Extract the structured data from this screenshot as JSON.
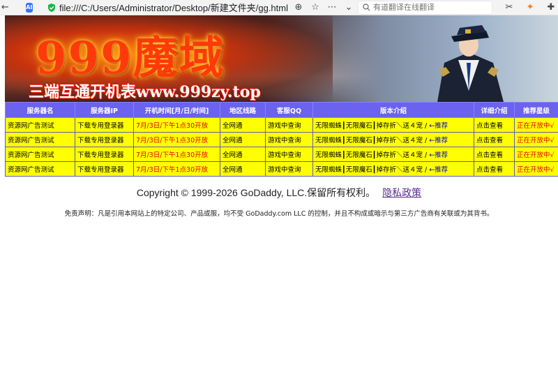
{
  "browser": {
    "url": "file:///C:/Users/Administrator/Desktop/新建文件夹/gg.html",
    "ai_label": "AI",
    "search_placeholder": "有道翻译在线翻译"
  },
  "banner": {
    "logo_text": "999魔域",
    "tagline": "三端互通开机表www.999zy.top"
  },
  "table": {
    "headers": [
      "服务器名",
      "服务器IP",
      "开机时间[月/日/时间]",
      "地区线路",
      "客服QQ",
      "版本介绍",
      "详细介绍",
      "推荐星级"
    ],
    "rows": [
      {
        "name": "资源网广告测试",
        "ip": "下载专用登录器",
        "time": "7月/3日/下午1点30开放",
        "region": "全网通",
        "qq": "游戏中查询",
        "version_main": "无限蜘蛛┃无限魔石┃掉存折＼送４宠 / ",
        "version_link": "←推荐",
        "detail": "点击查看",
        "rating": "正在开放中√"
      },
      {
        "name": "资源网广告测试",
        "ip": "下载专用登录器",
        "time": "7月/3日/下午1点30开放",
        "region": "全网通",
        "qq": "游戏中查询",
        "version_main": "无限蜘蛛┃无限魔石┃掉存折＼送４宠 / ",
        "version_link": "←推荐",
        "detail": "点击查看",
        "rating": "正在开放中√"
      },
      {
        "name": "资源网广告测试",
        "ip": "下载专用登录器",
        "time": "7月/3日/下午1点30开放",
        "region": "全网通",
        "qq": "游戏中查询",
        "version_main": "无限蜘蛛┃无限魔石┃掉存折＼送４宠 / ",
        "version_link": "←推荐",
        "detail": "点击查看",
        "rating": "正在开放中√"
      },
      {
        "name": "资源网广告测试",
        "ip": "下载专用登录器",
        "time": "7月/3日/下午1点30开放",
        "region": "全网通",
        "qq": "游戏中查询",
        "version_main": "无限蜘蛛┃无限魔石┃掉存折＼送４宠 / ",
        "version_link": "←推荐",
        "detail": "点击查看",
        "rating": "正在开放中√"
      }
    ]
  },
  "footer": {
    "copyright": "Copyright © 1999-2026 GoDaddy, LLC.保留所有权利。",
    "privacy_link": "隐私政策",
    "disclaimer": "免责声明：凡是引用本网站上的特定公司、产品或服，均不受 GoDaddy.com LLC 的控制，并且不构成或暗示与第三方广告商有关联或为其背书。"
  },
  "colors": {
    "header_bg": "#6b62f0",
    "row_bg": "#ffff00",
    "time_text": "#e00000",
    "rating_text": "#e00000",
    "link_text": "#0000cc"
  }
}
